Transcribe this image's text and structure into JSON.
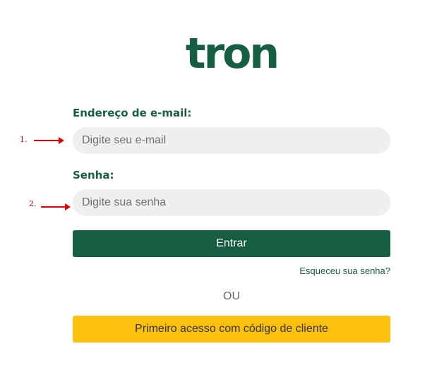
{
  "brand": {
    "logo_text": "tron",
    "primary_color": "#155e42",
    "accent_color": "#fcc10f"
  },
  "form": {
    "email": {
      "label": "Endereço de e-mail:",
      "placeholder": "Digite seu e-mail",
      "value": ""
    },
    "password": {
      "label": "Senha:",
      "placeholder": "Digite sua senha",
      "value": ""
    },
    "submit_label": "Entrar",
    "forgot_label": "Esqueceu sua senha?",
    "separator": "OU",
    "first_access_label": "Primeiro acesso com código de cliente"
  },
  "annotations": [
    {
      "label": "1.",
      "color": "#e00000"
    },
    {
      "label": "2.",
      "color": "#e00000"
    }
  ]
}
